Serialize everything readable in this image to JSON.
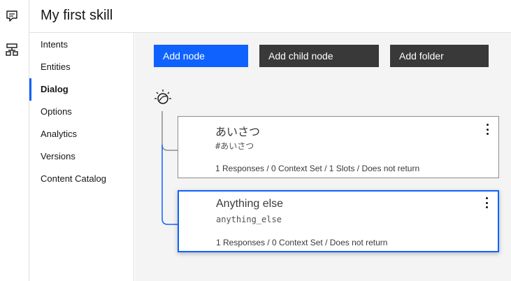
{
  "header": {
    "title": "My first skill"
  },
  "rail": {
    "icons": [
      "chat-icon",
      "workspace-icon"
    ]
  },
  "nav": {
    "items": [
      {
        "label": "Intents"
      },
      {
        "label": "Entities"
      },
      {
        "label": "Dialog",
        "active": true
      },
      {
        "label": "Options"
      },
      {
        "label": "Analytics"
      },
      {
        "label": "Versions"
      },
      {
        "label": "Content Catalog"
      }
    ]
  },
  "toolbar": {
    "add_node": "Add node",
    "add_child_node": "Add child node",
    "add_folder": "Add folder"
  },
  "nodes": [
    {
      "title": "あいさつ",
      "condition": "#あいさつ",
      "summary": "1 Responses / 0 Context Set / 1 Slots / Does not return"
    },
    {
      "title": "Anything else",
      "condition": "anything_else",
      "summary": "1 Responses / 0 Context Set / Does not return",
      "selected": true
    }
  ],
  "colors": {
    "accent": "#0f62fe",
    "secondary_button": "#393939",
    "canvas": "#f4f4f4"
  }
}
